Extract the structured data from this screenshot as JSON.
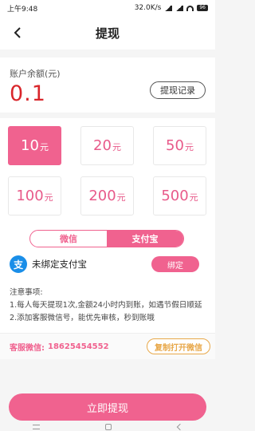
{
  "status_bar": {
    "time": "上午9:48",
    "speed": "32.0K/s",
    "battery": "96"
  },
  "header": {
    "title": "提现"
  },
  "balance": {
    "label": "账户余额(元)",
    "value": "0.1",
    "record_button": "提现记录"
  },
  "amounts": [
    {
      "value": "10",
      "unit": "元",
      "selected": true
    },
    {
      "value": "20",
      "unit": "元",
      "selected": false
    },
    {
      "value": "50",
      "unit": "元",
      "selected": false
    },
    {
      "value": "100",
      "unit": "元",
      "selected": false
    },
    {
      "value": "200",
      "unit": "元",
      "selected": false
    },
    {
      "value": "500",
      "unit": "元",
      "selected": false
    }
  ],
  "payment_tabs": [
    {
      "label": "微信",
      "active": false
    },
    {
      "label": "支付宝",
      "active": true
    }
  ],
  "alipay": {
    "icon_char": "支",
    "status": "未绑定支付宝",
    "bind_button": "绑定"
  },
  "notice": {
    "title": "注意事项:",
    "lines": [
      "1.每人每天提现1次,金额24小时内到账，如遇节假日顺延",
      "2.添加客服微信号，能优先审核，秒到账哦"
    ]
  },
  "service": {
    "label": "客服微信:",
    "number": "18625454552",
    "copy_button": "复制打开微信"
  },
  "withdraw_button": "立即提现",
  "colors": {
    "accent": "#f0628f",
    "balance": "#d9262b",
    "alipay": "#1a8ee8",
    "copy": "#e8a84a"
  }
}
